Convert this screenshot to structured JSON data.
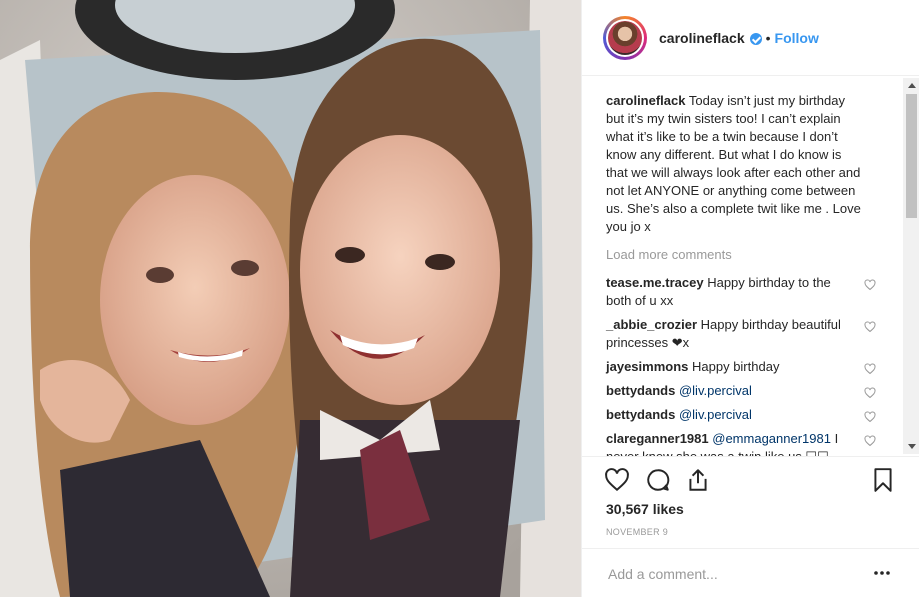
{
  "post": {
    "username": "carolineflack",
    "follow_label": "Follow",
    "dot": "•",
    "caption_text": "Today isn’t just my birthday but it’s my twin sisters too! I can’t explain what it’s like to be a twin because I don’t know any different. But what I do know is that we will always look after each other and not let ANYONE or anything come between us. She’s also a complete twit like me . Love you jo x",
    "load_more": "Load more comments",
    "comments": [
      {
        "user": "tease.me.tracey",
        "text": "Happy birthday to the both of u xx"
      },
      {
        "user": "_abbie_crozier",
        "text": "Happy birthday beautiful princesses ❤x"
      },
      {
        "user": "jayesimmons",
        "text": "Happy birthday"
      },
      {
        "user": "bettydands",
        "mention": "@liv.percival"
      },
      {
        "user": "bettydands",
        "mention": "@liv.percival"
      },
      {
        "user": "clareganner1981",
        "mention": "@emmaganner1981",
        "text": "I never knew she was a twin like us ☐☐"
      }
    ],
    "likes": "30,567 likes",
    "date": "NOVEMBER 9",
    "add_comment_placeholder": "Add a comment...",
    "icons": [
      "heart-icon",
      "comment-icon",
      "share-icon",
      "bookmark-icon",
      "more-options-icon",
      "verified-badge-icon"
    ]
  },
  "colors": {
    "link": "#3897f0",
    "mention": "#003569",
    "muted": "#999999"
  }
}
